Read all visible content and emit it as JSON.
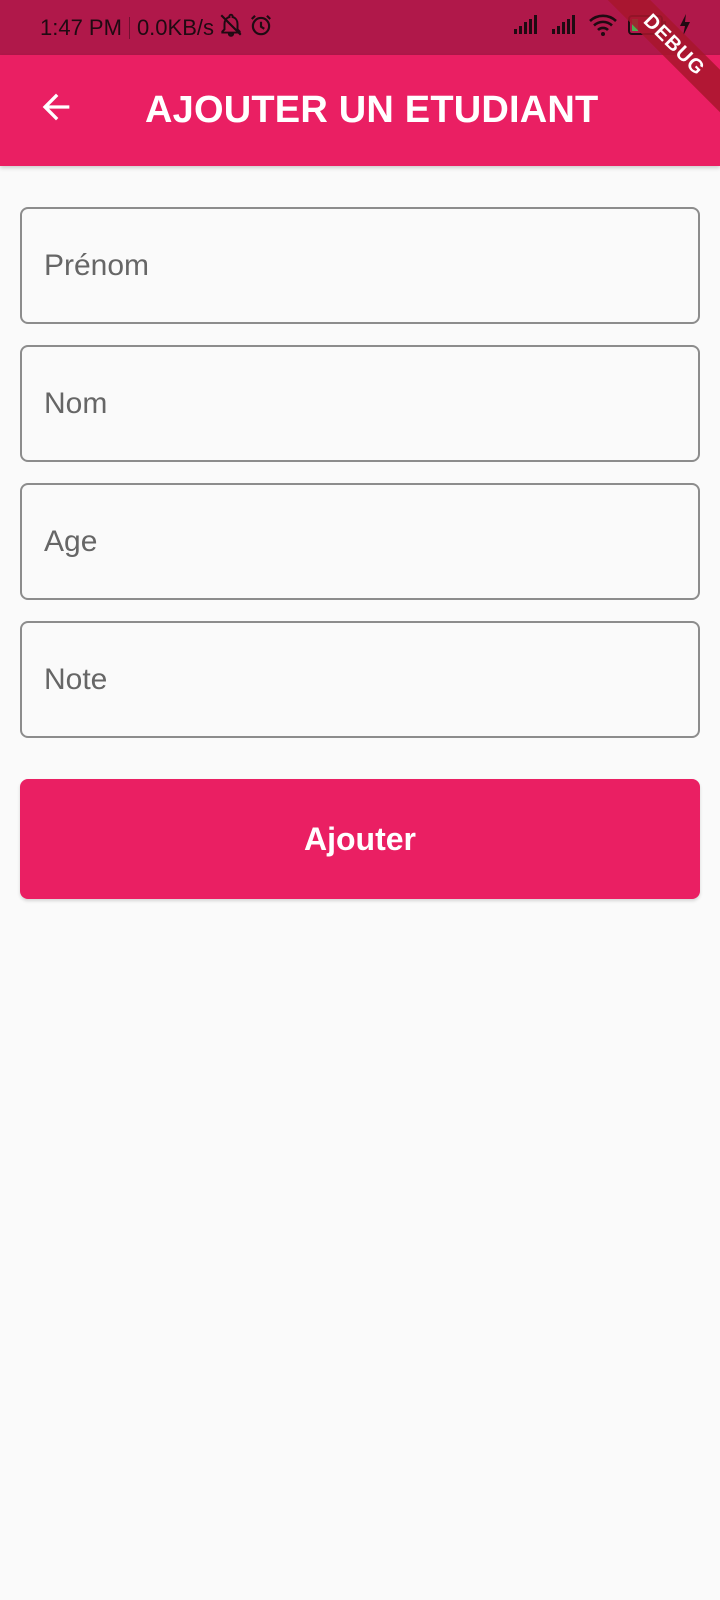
{
  "status_bar": {
    "time": "1:47 PM",
    "network_speed": "0.0KB/s",
    "icons_left": [
      "notifications-off-icon",
      "alarm-icon"
    ],
    "icons_right": [
      "signal-icon",
      "signal-icon",
      "wifi-icon",
      "battery-icon",
      "charging-icon"
    ]
  },
  "app_bar": {
    "title": "AJOUTER UN ETUDIANT",
    "back_icon": "arrow-left-icon",
    "background": "#ea1f63"
  },
  "debug_banner": {
    "label": "DEBUG"
  },
  "form": {
    "fields": [
      {
        "placeholder": "Prénom",
        "value": ""
      },
      {
        "placeholder": "Nom",
        "value": ""
      },
      {
        "placeholder": "Age",
        "value": ""
      },
      {
        "placeholder": "Note",
        "value": ""
      }
    ],
    "submit_label": "Ajouter"
  },
  "colors": {
    "primary": "#ea1f63",
    "status_bar": "#b0184a",
    "background": "#fafafa",
    "field_border": "#8c8c8c"
  }
}
